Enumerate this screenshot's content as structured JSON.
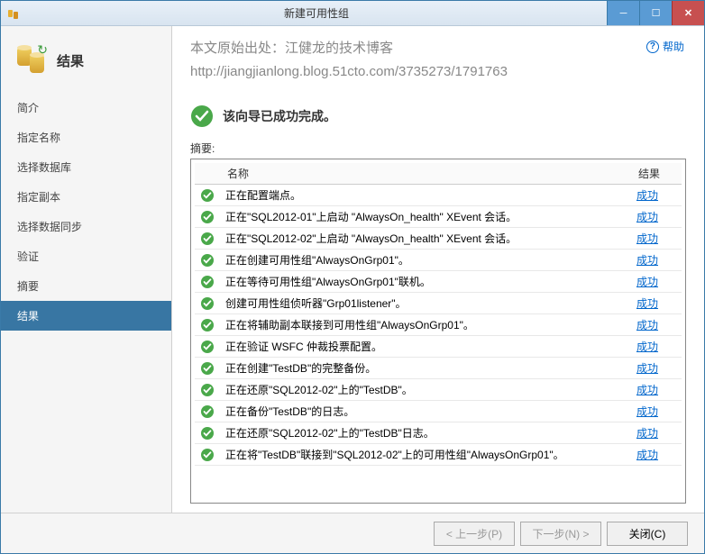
{
  "titlebar": {
    "title": "新建可用性组"
  },
  "sidebar": {
    "header_title": "结果",
    "items": [
      {
        "label": "简介"
      },
      {
        "label": "指定名称"
      },
      {
        "label": "选择数据库"
      },
      {
        "label": "指定副本"
      },
      {
        "label": "选择数据同步"
      },
      {
        "label": "验证"
      },
      {
        "label": "摘要"
      },
      {
        "label": "结果",
        "active": true
      }
    ]
  },
  "watermark": {
    "line1": "本文原始出处：江健龙的技术博客",
    "line2": "http://jiangjianlong.blog.51cto.com/3735273/1791763"
  },
  "help_label": "帮助",
  "banner_text": "该向导已成功完成。",
  "summary_label": "摘要:",
  "columns": {
    "name": "名称",
    "result": "结果"
  },
  "rows": [
    {
      "name": "正在配置端点。",
      "result": "成功"
    },
    {
      "name": "正在\"SQL2012-01\"上启动 \"AlwaysOn_health\" XEvent 会话。",
      "result": "成功"
    },
    {
      "name": "正在\"SQL2012-02\"上启动 \"AlwaysOn_health\" XEvent 会话。",
      "result": "成功"
    },
    {
      "name": "正在创建可用性组\"AlwaysOnGrp01\"。",
      "result": "成功"
    },
    {
      "name": "正在等待可用性组\"AlwaysOnGrp01\"联机。",
      "result": "成功"
    },
    {
      "name": "创建可用性组侦听器\"Grp01listener\"。",
      "result": "成功"
    },
    {
      "name": "正在将辅助副本联接到可用性组\"AlwaysOnGrp01\"。",
      "result": "成功"
    },
    {
      "name": "正在验证 WSFC 仲裁投票配置。",
      "result": "成功"
    },
    {
      "name": "正在创建\"TestDB\"的完整备份。",
      "result": "成功"
    },
    {
      "name": "正在还原\"SQL2012-02\"上的\"TestDB\"。",
      "result": "成功"
    },
    {
      "name": "正在备份\"TestDB\"的日志。",
      "result": "成功"
    },
    {
      "name": "正在还原\"SQL2012-02\"上的\"TestDB\"日志。",
      "result": "成功"
    },
    {
      "name": "正在将\"TestDB\"联接到\"SQL2012-02\"上的可用性组\"AlwaysOnGrp01\"。",
      "result": "成功"
    }
  ],
  "footer": {
    "prev": "< 上一步(P)",
    "next": "下一步(N) >",
    "close": "关闭(C)"
  }
}
